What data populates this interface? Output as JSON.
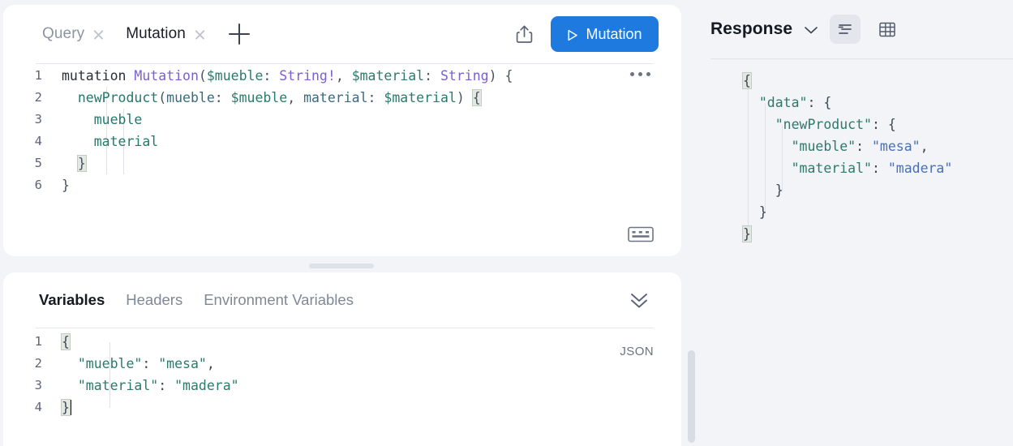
{
  "window": {
    "background": "#f2f4f7",
    "accent": "#1f7ae0"
  },
  "operation_panel": {
    "tabs": [
      {
        "label": "Query",
        "active": false,
        "close_icon": "close-icon"
      },
      {
        "label": "Mutation",
        "active": true,
        "close_icon": "close-icon"
      }
    ],
    "add_tab_icon": "plus-icon",
    "share_icon": "share-icon",
    "run_button": {
      "label": "Mutation",
      "icon": "play-icon",
      "color": "#1f7ae0"
    },
    "keyboard_icon": "keyboard-icon",
    "fold_icon": "ellipsis-icon",
    "editor": {
      "language": "graphql",
      "line_numbers": [
        "1",
        "2",
        "3",
        "4",
        "5",
        "6"
      ],
      "lines": [
        "mutation Mutation($mueble: String!, $material: String) {",
        "  newProduct(mueble: $mueble, material: $material) {",
        "    mueble",
        "    material",
        "  }",
        "}"
      ],
      "tokens": {
        "keyword": "mutation",
        "operation_name": "Mutation",
        "var_mueble": "$mueble",
        "var_material": "$material",
        "type_string_required": "String!",
        "type_string": "String",
        "field_newProduct": "newProduct",
        "arg_mueble": "mueble",
        "arg_material": "material",
        "selection_mueble": "mueble",
        "selection_material": "material"
      }
    }
  },
  "variables_panel": {
    "tabs": [
      {
        "label": "Variables",
        "active": true
      },
      {
        "label": "Headers",
        "active": false
      },
      {
        "label": "Environment Variables",
        "active": false
      }
    ],
    "collapse_icon": "double-chevron-down-icon",
    "format_badge": "JSON",
    "editor": {
      "line_numbers": [
        "1",
        "2",
        "3",
        "4"
      ],
      "lines": [
        "{",
        "  \"mueble\": \"mesa\",",
        "  \"material\": \"madera\"",
        "}"
      ],
      "values": {
        "mueble": "mesa",
        "material": "madera"
      }
    }
  },
  "response_panel": {
    "title": "Response",
    "title_chevron_icon": "chevron-down-icon",
    "view_buttons": [
      {
        "icon": "format-lines-icon",
        "active": true
      },
      {
        "icon": "table-grid-icon",
        "active": false
      }
    ],
    "body_lines": [
      "{",
      "  \"data\": {",
      "    \"newProduct\": {",
      "      \"mueble\": \"mesa\",",
      "      \"material\": \"madera\"",
      "    }",
      "  }",
      "}"
    ],
    "parsed": {
      "data": {
        "newProduct": {
          "mueble": "mesa",
          "material": "madera"
        }
      }
    }
  }
}
